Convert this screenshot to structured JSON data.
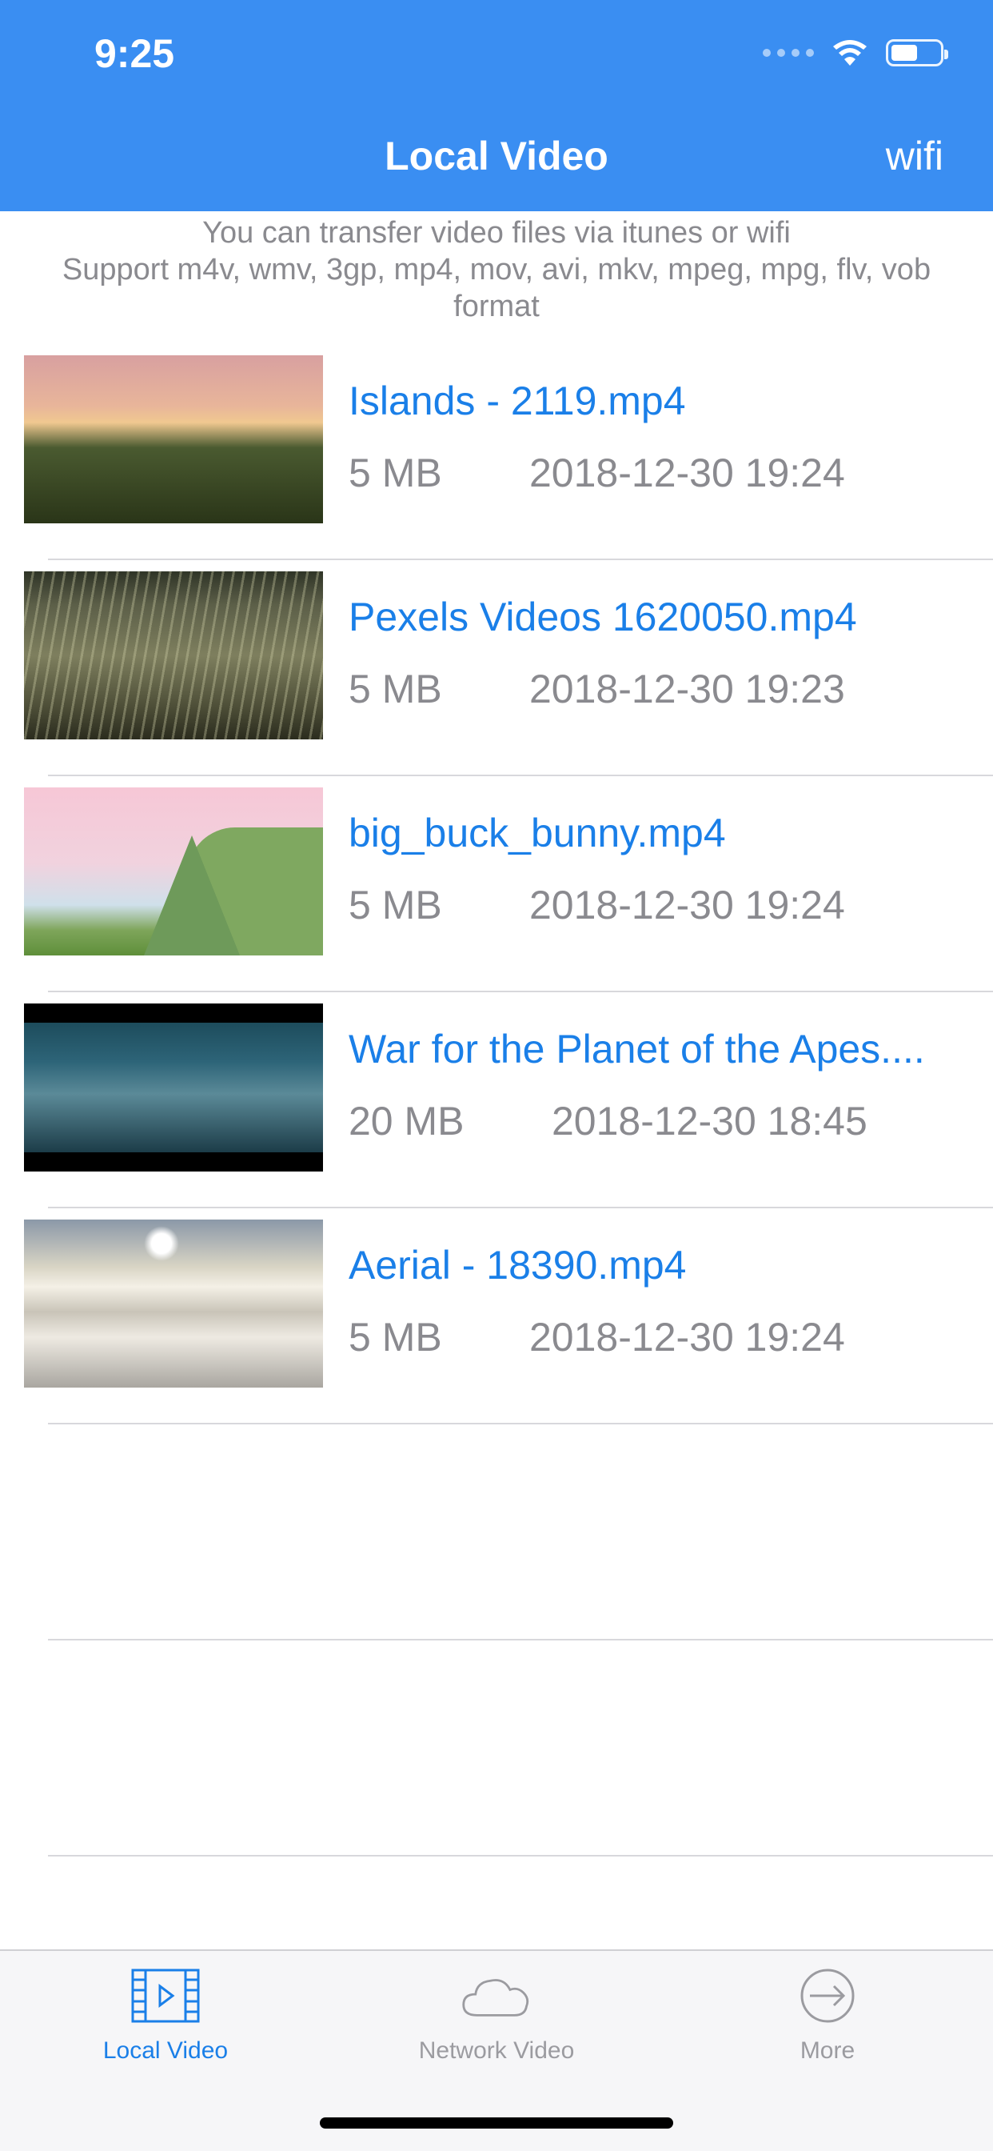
{
  "status_bar": {
    "time": "9:25",
    "icons": [
      "signal-dots-icon",
      "wifi-icon",
      "battery-icon"
    ]
  },
  "nav": {
    "title": "Local Video",
    "right_button": "wifi"
  },
  "info": {
    "line1": "You can transfer video files via itunes or wifi",
    "line2": "Support m4v, wmv, 3gp, mp4, mov, avi, mkv, mpeg, mpg, flv, vob format"
  },
  "videos": [
    {
      "title": "Islands - 2119.mp4",
      "size": "5 MB",
      "date": "2018-12-30 19:24"
    },
    {
      "title": "Pexels Videos 1620050.mp4",
      "size": "5 MB",
      "date": "2018-12-30 19:23"
    },
    {
      "title": "big_buck_bunny.mp4",
      "size": "5 MB",
      "date": "2018-12-30 19:24"
    },
    {
      "title": "War for the Planet of the Apes....",
      "size": "20 MB",
      "date": "2018-12-30 18:45"
    },
    {
      "title": "Aerial - 18390.mp4",
      "size": "5 MB",
      "date": "2018-12-30 19:24"
    }
  ],
  "tabs": [
    {
      "label": "Local Video",
      "icon": "film-icon",
      "active": true
    },
    {
      "label": "Network Video",
      "icon": "cloud-icon",
      "active": false
    },
    {
      "label": "More",
      "icon": "arrow-circle-icon",
      "active": false
    }
  ],
  "colors": {
    "accent": "#3a8ef2",
    "link": "#1a7fe8",
    "secondary_text": "#8a8a8f"
  }
}
